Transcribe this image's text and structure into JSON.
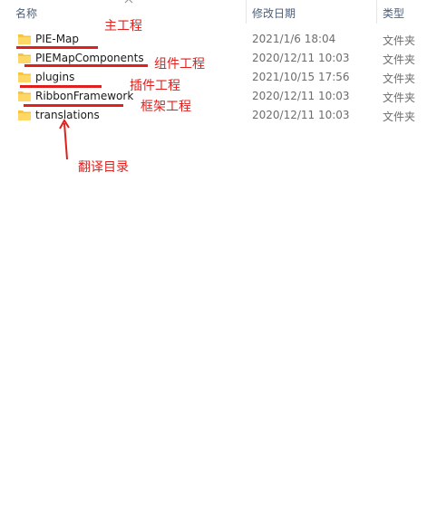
{
  "header": {
    "name_label": "名称",
    "date_label": "修改日期",
    "type_label": "类型"
  },
  "files": [
    {
      "name": "PIE-Map",
      "date": "2021/1/6 18:04",
      "type": "文件夹"
    },
    {
      "name": "PIEMapComponents",
      "date": "2020/12/11 10:03",
      "type": "文件夹"
    },
    {
      "name": "plugins",
      "date": "2021/10/15 17:56",
      "type": "文件夹"
    },
    {
      "name": "RibbonFramework",
      "date": "2020/12/11 10:03",
      "type": "文件夹"
    },
    {
      "name": "translations",
      "date": "2020/12/11 10:03",
      "type": "文件夹"
    }
  ],
  "annotations": {
    "main_project": "主工程",
    "component_project": "组件工程",
    "plugin_project": "插件工程",
    "framework_project": "框架工程",
    "translation_dir": "翻译目录"
  },
  "colors": {
    "annotation": "#e0201c",
    "folder": "#f5c542",
    "header_text": "#4c607a"
  }
}
